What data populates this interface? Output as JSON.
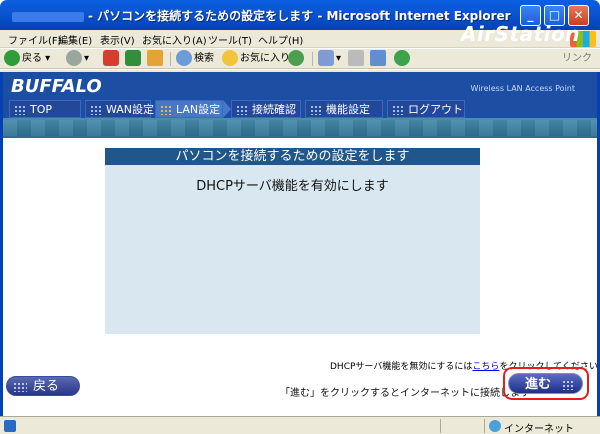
{
  "window": {
    "title": "- パソコンを接続するための設定をします - Microsoft Internet Explorer",
    "buttons": {
      "minimize": "_",
      "maximize": "□",
      "close": "✕"
    }
  },
  "menu": {
    "items": [
      "ファイル(F)",
      "編集(E)",
      "表示(V)",
      "お気に入り(A)",
      "ツール(T)",
      "ヘルプ(H)"
    ]
  },
  "toolbar": {
    "back": "戻る",
    "search": "検索",
    "favorites": "お気に入り",
    "links": "リンク"
  },
  "header": {
    "brand": "BUFFALO",
    "product_sub": "Wireless LAN Access Point",
    "product": "AirStation"
  },
  "nav": {
    "tabs": [
      "TOP",
      "WAN設定",
      "LAN設定",
      "接続確認",
      "機能設定",
      "ログアウト"
    ],
    "active": "LAN設定"
  },
  "panel": {
    "title": "パソコンを接続するための設定をします",
    "message": "DHCPサーバ機能を有効にします"
  },
  "note": {
    "prefix": "DHCPサーバ機能を無効にするには",
    "link": "こちら",
    "suffix": "をクリックしてください"
  },
  "footer": {
    "instruction": "「進む」をクリックするとインターネットに接続します",
    "back_button": "戻る",
    "next_button": "進む"
  },
  "status": {
    "zone": "インターネット"
  },
  "colors": {
    "accent_blue": "#1c4ea3",
    "panel_bg": "#d9e7f1",
    "highlight_ring": "#e0201f"
  }
}
